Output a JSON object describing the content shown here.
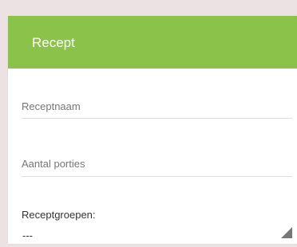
{
  "card": {
    "title": "Recept"
  },
  "fields": {
    "recipe_name_placeholder": "Receptnaam",
    "portions_placeholder": "Aantal porties"
  },
  "recipe_groups": {
    "label": "Receptgroepen:",
    "selected_value": "---"
  },
  "colors": {
    "header_accent": "#8bc34a",
    "page_background": "#ece2e3"
  },
  "icons": {
    "resize": "resize-grip-icon"
  }
}
